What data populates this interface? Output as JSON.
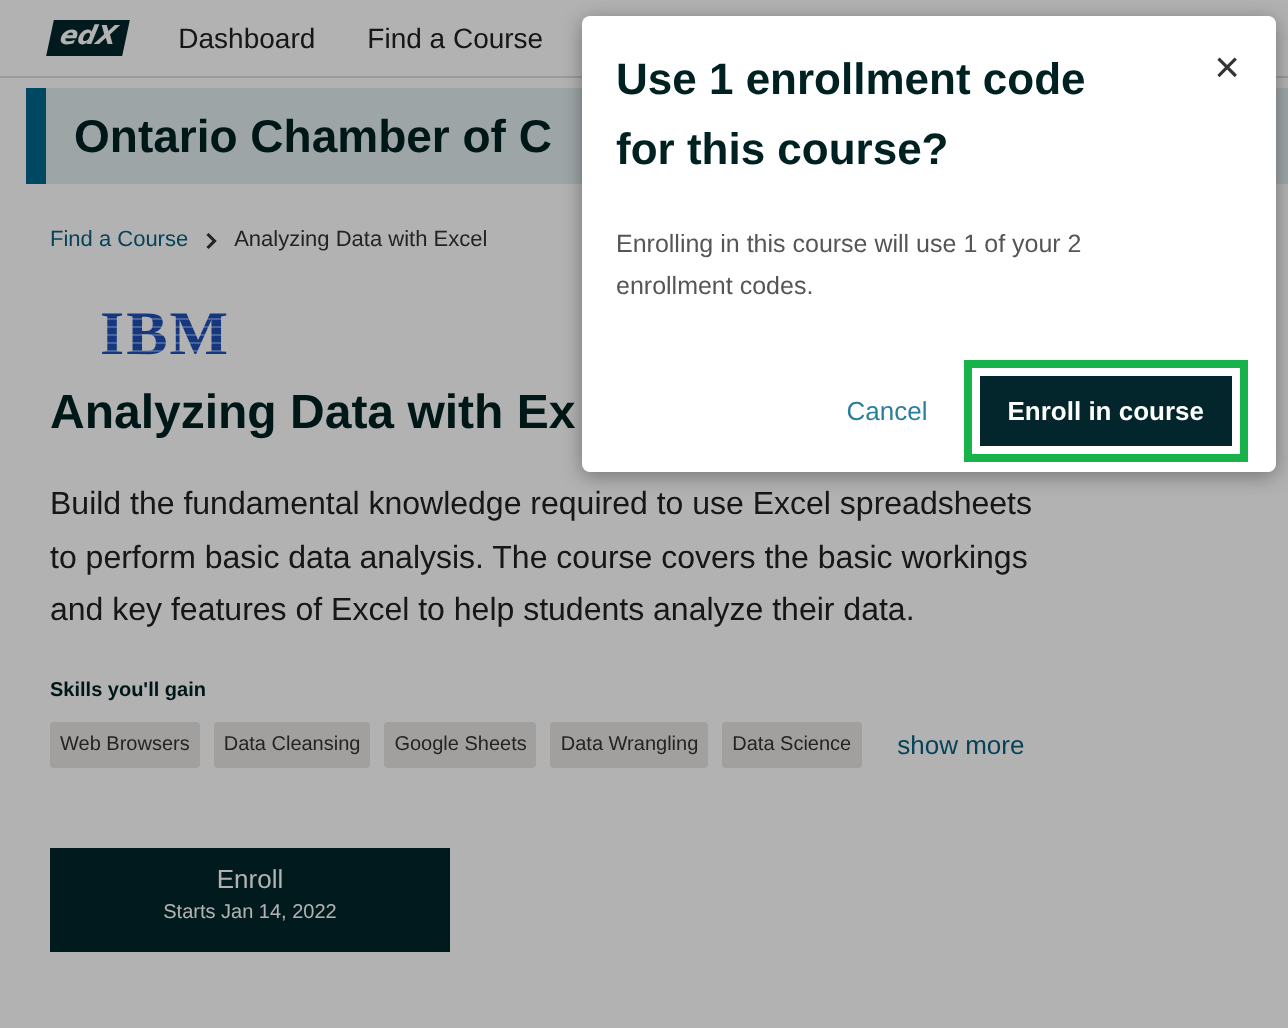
{
  "nav": {
    "logo": "edX",
    "links": [
      {
        "label": "Dashboard"
      },
      {
        "label": "Find a Course"
      }
    ]
  },
  "banner": {
    "title": "Ontario Chamber of C"
  },
  "breadcrumb": [
    {
      "label": "Find a Course",
      "kind": "link"
    },
    {
      "label": "Analyzing Data with Excel",
      "kind": "current"
    }
  ],
  "course": {
    "logo": "IBM",
    "title": "Analyzing Data with Ex",
    "description": "Build the fundamental knowledge required to use Excel spreadsheets to perform basic data analysis. The course covers the basic workings and key features of Excel to help students analyze their data.",
    "skills_heading": "Skills you'll gain",
    "skills": [
      "Web Browsers",
      "Data Cleansing",
      "Google Sheets",
      "Data Wrangling",
      "Data Science"
    ],
    "show_more": "show more",
    "enroll": {
      "label": "Enroll",
      "starts": "Starts Jan 14, 2022"
    }
  },
  "dialog": {
    "title": "Use 1 enrollment code for this course?",
    "close": "×",
    "message": "Enrolling in this course will use 1 of your 2 enrollment codes.",
    "cancel": "Cancel",
    "confirm": {
      "label": "Enroll in course",
      "highlighted": true
    }
  }
}
